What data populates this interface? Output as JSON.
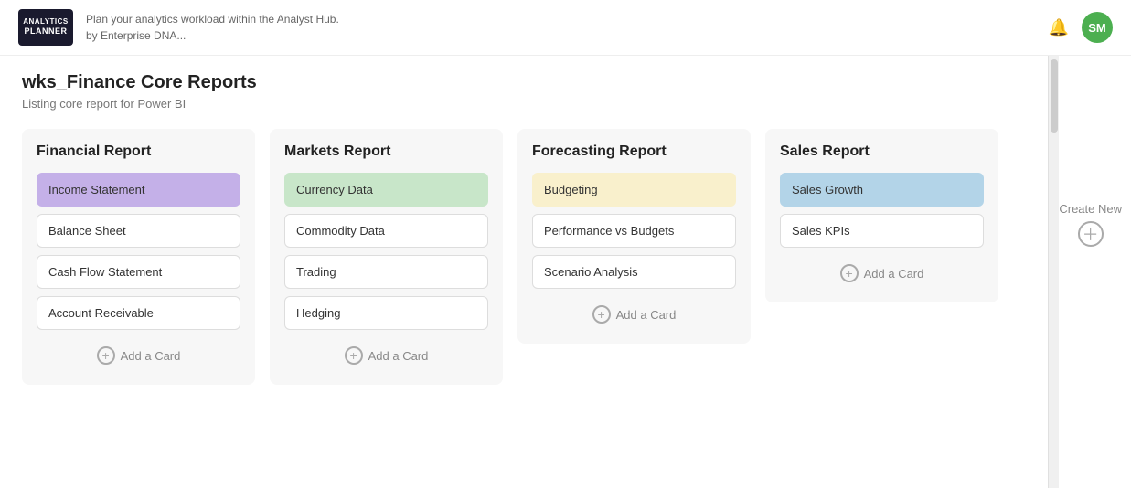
{
  "header": {
    "logo_line1": "ANALYTICS",
    "logo_line2": "PLANNER",
    "tagline_line1": "Plan your analytics workload within the Analyst Hub.",
    "tagline_line2": "by Enterprise DNA...",
    "avatar_initials": "SM"
  },
  "page": {
    "title": "wks_Finance Core Reports",
    "subtitle": "Listing core report for Power BI"
  },
  "boards": [
    {
      "id": "financial",
      "title": "Financial Report",
      "cards": [
        {
          "label": "Income Statement",
          "style": "purple"
        },
        {
          "label": "Balance Sheet",
          "style": "white"
        },
        {
          "label": "Cash Flow Statement",
          "style": "white"
        },
        {
          "label": "Account Receivable",
          "style": "white"
        }
      ]
    },
    {
      "id": "markets",
      "title": "Markets Report",
      "cards": [
        {
          "label": "Currency Data",
          "style": "green"
        },
        {
          "label": "Commodity Data",
          "style": "white"
        },
        {
          "label": "Trading",
          "style": "white"
        },
        {
          "label": "Hedging",
          "style": "white"
        }
      ]
    },
    {
      "id": "forecasting",
      "title": "Forecasting Report",
      "cards": [
        {
          "label": "Budgeting",
          "style": "yellow"
        },
        {
          "label": "Performance vs Budgets",
          "style": "white"
        },
        {
          "label": "Scenario Analysis",
          "style": "white"
        }
      ]
    },
    {
      "id": "sales",
      "title": "Sales Report",
      "cards": [
        {
          "label": "Sales Growth",
          "style": "blue"
        },
        {
          "label": "Sales KPIs",
          "style": "white"
        }
      ]
    }
  ],
  "add_card_label": "Add a Card",
  "create_new_label": "Create New"
}
